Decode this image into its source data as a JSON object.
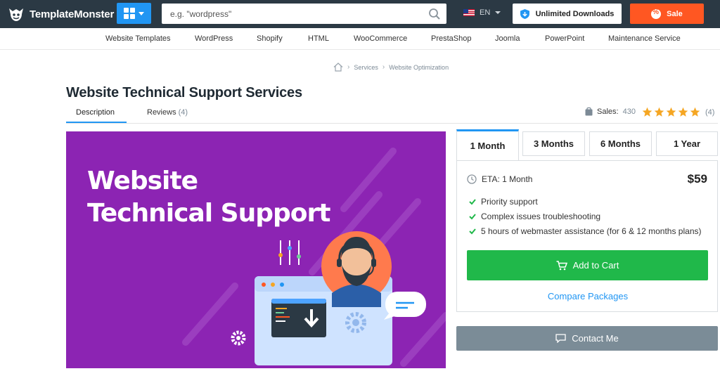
{
  "header": {
    "logo_text": "TemplateMonster",
    "search_placeholder": "e.g. \"wordpress\"",
    "language": "EN",
    "unlimited_label": "Unlimited Downloads",
    "sale_label": "Sale"
  },
  "category_nav": [
    "Website Templates",
    "WordPress",
    "Shopify",
    "HTML",
    "WooCommerce",
    "PrestaShop",
    "Joomla",
    "PowerPoint",
    "Maintenance Service"
  ],
  "breadcrumb": {
    "items": [
      "Services",
      "Website Optimization"
    ]
  },
  "product": {
    "title": "Website Technical Support Services",
    "tabs": {
      "description": "Description",
      "reviews": "Reviews",
      "reviews_count": "(4)"
    },
    "sales_label": "Sales:",
    "sales_count": "430",
    "rating_stars": 5,
    "rating_count": "(4)",
    "hero_text_line1": "Website",
    "hero_text_line2": "Technical Support"
  },
  "plans": {
    "tabs": [
      "1 Month",
      "3 Months",
      "6 Months",
      "1 Year"
    ],
    "selected": "1 Month",
    "eta": "ETA: 1 Month",
    "price": "$59",
    "features": [
      "Priority support",
      "Complex issues troubleshooting",
      "5 hours of webmaster assistance (for 6 & 12 months plans)"
    ],
    "add_to_cart": "Add to Cart",
    "compare": "Compare Packages"
  },
  "contact_label": "Contact Me",
  "colors": {
    "header_bg": "#2b3944",
    "accent_blue": "#2196f3",
    "sale_orange": "#ff5722",
    "cart_green": "#20b84a",
    "hero_purple": "#8c24b3",
    "contact_gray": "#7b8c97",
    "star_yellow": "#f5a623"
  },
  "icons": [
    "monster-logo-icon",
    "grid-icon",
    "search-icon",
    "us-flag-icon",
    "shield-icon",
    "discount-icon",
    "home-icon",
    "bag-icon",
    "star-icon",
    "clock-icon",
    "check-icon",
    "cart-icon",
    "chat-icon"
  ]
}
